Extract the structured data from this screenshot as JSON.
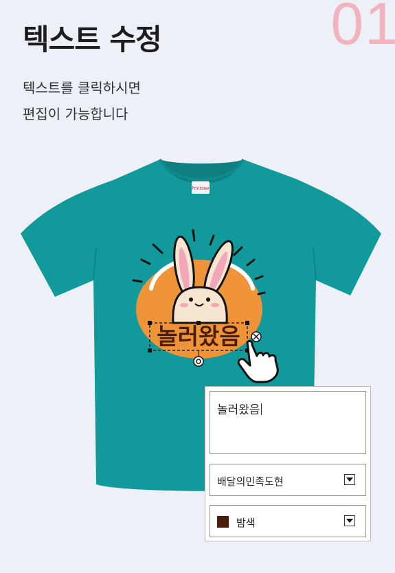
{
  "header": {
    "step_number": "01",
    "title": "텍스트 수정",
    "desc_line1": "텍스트를 클릭하시면",
    "desc_line2": "편집이 가능합니다"
  },
  "design": {
    "text": "놀러왔음",
    "shirt_color": "#12999b",
    "sun_color": "#f0943a"
  },
  "editor": {
    "text_value": "놀러왔음",
    "font_select": {
      "value": "배달의민족도현"
    },
    "color_select": {
      "value": "밤색",
      "swatch": "#4a1e08"
    }
  }
}
